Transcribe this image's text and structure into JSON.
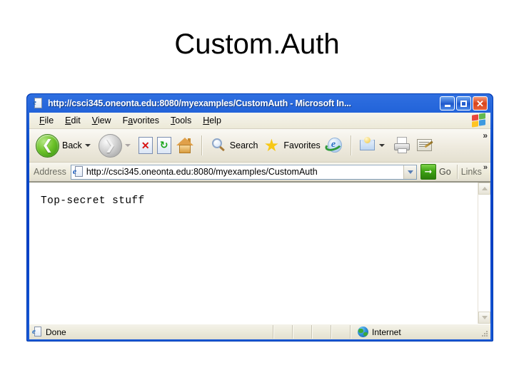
{
  "slide": {
    "title": "Custom.Auth"
  },
  "browser": {
    "titlebar": {
      "icon": "ie-page-icon",
      "text": "http://csci345.oneonta.edu:8080/myexamples/CustomAuth - Microsoft In...",
      "buttons": {
        "minimize": "minimize-button",
        "maximize": "maximize-button",
        "close": "close-button"
      }
    },
    "menu": {
      "items": [
        {
          "label": "File",
          "accel": "F",
          "rest": "ile"
        },
        {
          "label": "Edit",
          "accel": "E",
          "rest": "dit"
        },
        {
          "label": "View",
          "accel": "V",
          "rest": "iew"
        },
        {
          "label": "Favorites",
          "accel_pre": "Fa",
          "accel": "v",
          "rest": "orites"
        },
        {
          "label": "Tools",
          "accel": "T",
          "rest": "ools"
        },
        {
          "label": "Help",
          "accel": "H",
          "rest": "elp"
        }
      ],
      "logo": "windows-flag-logo"
    },
    "toolbar": {
      "back_label": "Back",
      "search_label": "Search",
      "favorites_label": "Favorites",
      "overflow": "»",
      "icons": [
        "back-icon",
        "forward-icon",
        "stop-icon",
        "refresh-icon",
        "home-icon",
        "search-icon",
        "favorites-star-icon",
        "media-icon",
        "mail-icon",
        "print-icon",
        "edit-icon"
      ]
    },
    "addressbar": {
      "label": "Address",
      "url": "http://csci345.oneonta.edu:8080/myexamples/CustomAuth",
      "placeholder": "http://",
      "go_label": "Go",
      "links_label": "Links",
      "overflow": "»"
    },
    "page": {
      "content_text": "Top-secret stuff"
    },
    "statusbar": {
      "status_text": "Done",
      "zone_text": "Internet"
    },
    "colors": {
      "title_bar_blue": "#0a4ccc",
      "close_red": "#d8431b",
      "client_face": "#ece9d8",
      "go_green": "#3ea313",
      "back_green": "#6fc32b"
    }
  }
}
